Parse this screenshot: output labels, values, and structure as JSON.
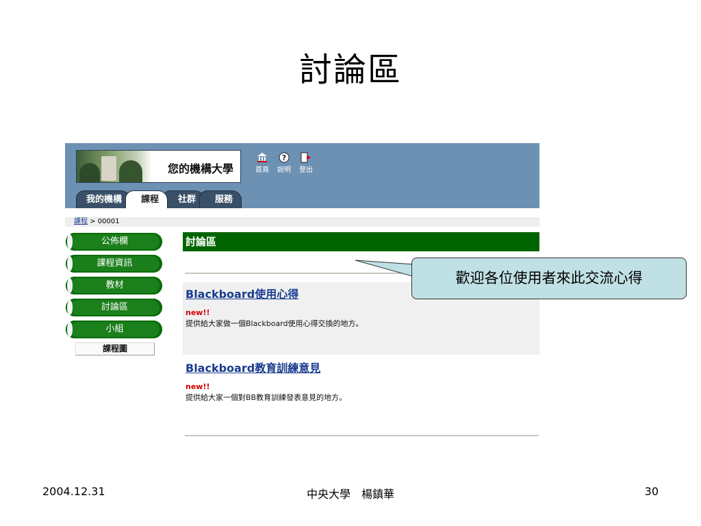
{
  "slide": {
    "title": "討論區",
    "footer_left": "2004.12.31",
    "footer_center": "中央大學　楊鎮華",
    "footer_right": "30"
  },
  "header": {
    "logo_text": "您的機構大學",
    "top_links": [
      {
        "label": "首頁",
        "icon": "home-icon"
      },
      {
        "label": "說明",
        "icon": "help-icon"
      },
      {
        "label": "登出",
        "icon": "logout-icon"
      }
    ],
    "tabs": [
      "我的機構",
      "課程",
      "社群",
      "服務"
    ],
    "active_tab": "課程"
  },
  "breadcrumb": {
    "link": "課程",
    "separator": " > ",
    "current": "00001"
  },
  "menu": {
    "items": [
      "公佈欄",
      "課程資訊",
      "教材",
      "討論區",
      "小組"
    ],
    "map_label": "課程圖"
  },
  "content": {
    "title": "討論區",
    "forums": [
      {
        "name": "Blackboard使用心得",
        "badge": "new!!",
        "description": "提供給大家做一個Blackboard使用心得交換的地方。"
      },
      {
        "name": "Blackboard教育訓練意見",
        "badge": "new!!",
        "description": "提供給大家一個對BB教育訓練發表意見的地方。"
      }
    ]
  },
  "callout": {
    "text": "歡迎各位使用者來此交流心得"
  },
  "colors": {
    "header_bg": "#6d91b3",
    "menu_green": "#1b7f1b",
    "title_green": "#006400",
    "callout_bg": "#bfe0e4",
    "link_blue": "#1a3c8f",
    "new_red": "#d40000"
  }
}
